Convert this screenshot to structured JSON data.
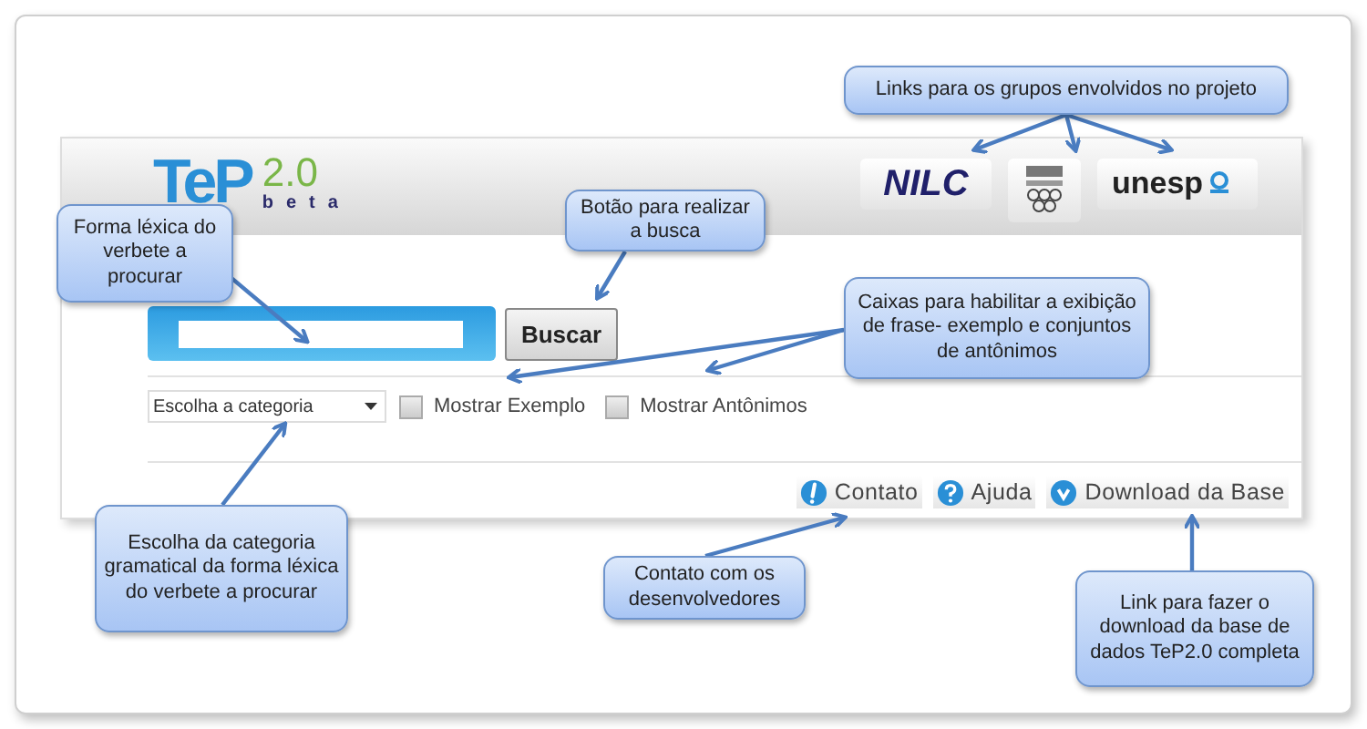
{
  "app": {
    "logo": {
      "name": "TeP",
      "version": "2.0",
      "tag": "beta"
    },
    "partner_links": [
      {
        "kind": "wordmark",
        "label": "NILC"
      },
      {
        "kind": "emblem"
      },
      {
        "kind": "unesp",
        "label": "unesp"
      }
    ],
    "search": {
      "button": "Buscar"
    },
    "options": {
      "category_select": "Escolha a categoria",
      "checkboxes": [
        {
          "label": "Mostrar Exemplo",
          "checked": false
        },
        {
          "label": "Mostrar Antônimos",
          "checked": false
        }
      ]
    },
    "footer_links": [
      {
        "kind": "contact",
        "label": "Contato"
      },
      {
        "kind": "help",
        "label": "Ajuda"
      },
      {
        "kind": "download",
        "label": "Download da Base"
      }
    ]
  },
  "callouts": [
    {
      "text": "Links para os grupos envolvidos no projeto"
    },
    {
      "text": "Forma léxica do verbete a procurar"
    },
    {
      "text": "Botão para realizar a busca"
    },
    {
      "text": "Caixas para habilitar a exibição de frase- exemplo e conjuntos de antônimos"
    },
    {
      "text": "Escolha da categoria gramatical da forma léxica do verbete a procurar"
    },
    {
      "text": "Contato com os desenvolvedores"
    },
    {
      "text": "Link para fazer o download da base de dados TeP2.0 completa"
    }
  ]
}
